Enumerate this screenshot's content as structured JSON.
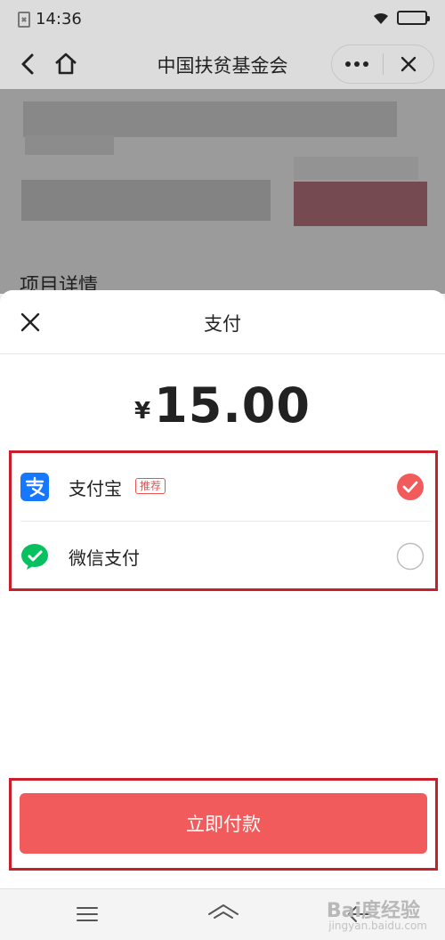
{
  "status_bar": {
    "time": "14:36"
  },
  "nav": {
    "title": "中国扶贫基金会"
  },
  "background_page": {
    "section_title": "项目详情"
  },
  "payment_sheet": {
    "title": "支付",
    "currency_symbol": "¥",
    "amount": "15.00",
    "methods": [
      {
        "label": "支付宝",
        "tag": "推荐",
        "icon": "alipay-icon",
        "selected": true
      },
      {
        "label": "微信支付",
        "icon": "wechat-pay-icon",
        "selected": false
      }
    ],
    "pay_button_label": "立即付款"
  },
  "colors": {
    "accent": "#f25b5b",
    "highlight_frame": "#c8202a",
    "alipay_blue": "#1677ff",
    "wechat_green": "#07c160"
  },
  "watermark": {
    "text": "Bai度经验",
    "sub": "jingyan.baidu.com"
  }
}
